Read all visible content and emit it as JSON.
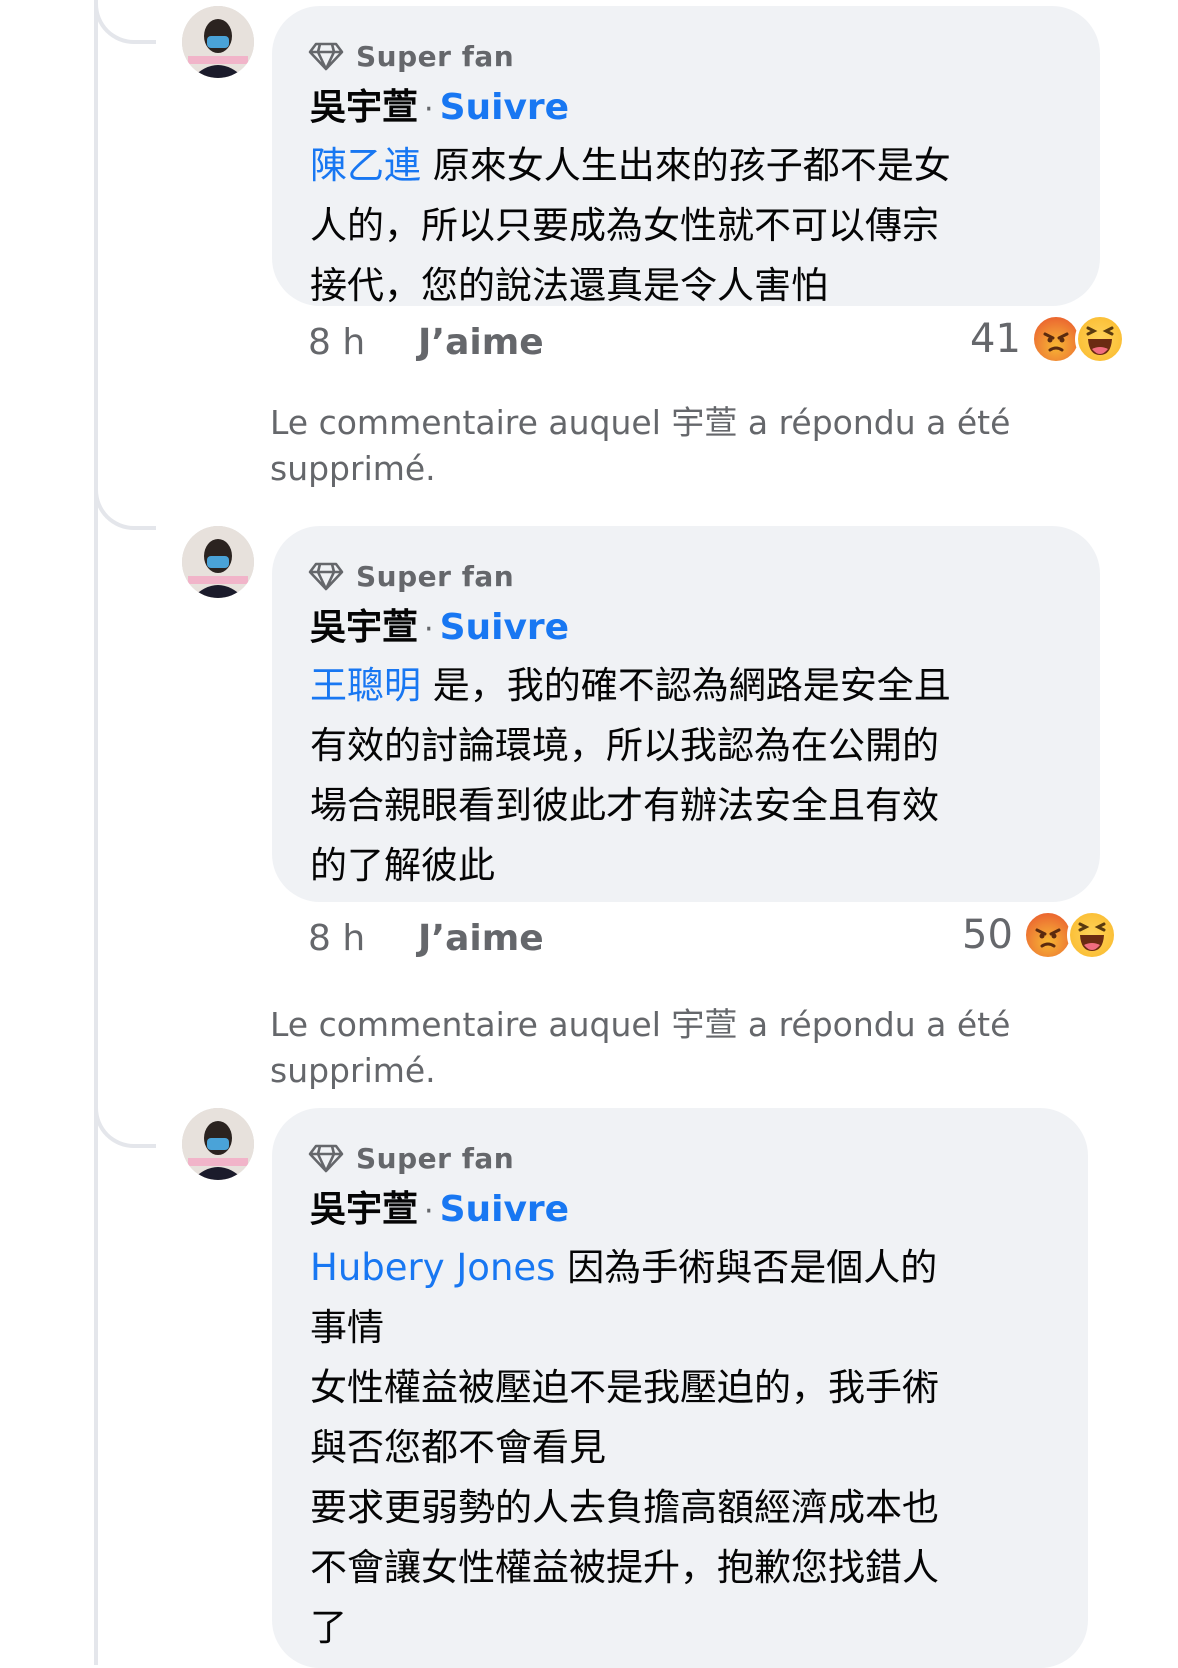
{
  "comments": [
    {
      "badge": "Super fan",
      "author": "吳宇萱",
      "separator": "·",
      "follow": "Suivre",
      "mention": "陳乙連",
      "text": " 原來女人生出來的孩子都不是女\n人的，所以只要成為女性就不可以傳宗\n接代，您的說法還真是令人害怕",
      "time": "8 h",
      "like": "J’aime",
      "reaction_count": "41",
      "reactions": [
        "angry",
        "haha"
      ]
    },
    {
      "badge": "Super fan",
      "author": "吳宇萱",
      "separator": "·",
      "follow": "Suivre",
      "mention": "王聰明",
      "text": " 是，我的確不認為網路是安全且\n有效的討論環境，所以我認為在公開的\n場合親眼看到彼此才有辦法安全且有效\n的了解彼此",
      "time": "8 h",
      "like": "J’aime",
      "reaction_count": "50",
      "reactions": [
        "angry",
        "haha"
      ]
    },
    {
      "badge": "Super fan",
      "author": "吳宇萱",
      "separator": "·",
      "follow": "Suivre",
      "mention": "Hubery Jones",
      "text": " 因為手術與否是個人的\n事情\n女性權益被壓迫不是我壓迫的，我手術\n與否您都不會看見\n要求更弱勢的人去負擔高額經濟成本也\n不會讓女性權益被提升，抱歉您找錯人\n了"
    }
  ],
  "deleted_notice": "Le commentaire auquel 宇萱 a répondu a été supprimé.",
  "colors": {
    "link": "#1877f2",
    "secondary_text": "#65676b",
    "bubble": "#f0f2f5"
  }
}
